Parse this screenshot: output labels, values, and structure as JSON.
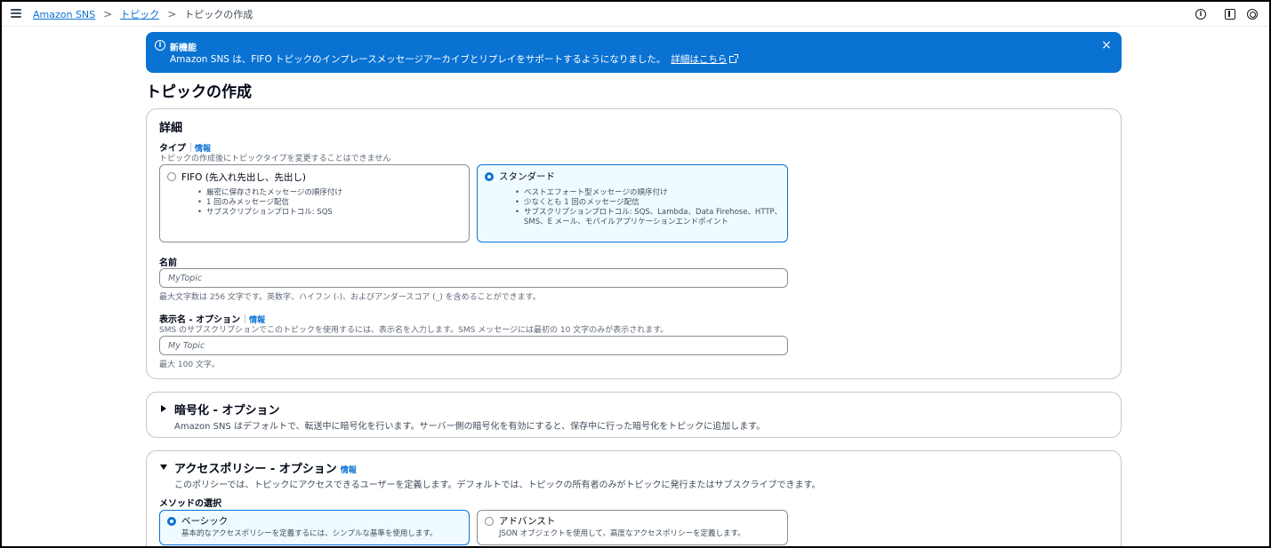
{
  "breadcrumb": {
    "items": [
      {
        "label": "Amazon SNS"
      },
      {
        "label": "トピック"
      }
    ],
    "current": "トピックの作成",
    "separator": ">"
  },
  "topbar": {
    "icons": [
      "info-icon",
      "panel-icon",
      "settings-icon"
    ]
  },
  "flash": {
    "title": "新機能",
    "message": "Amazon SNS は、FIFO トピックのインプレースメッセージアーカイブとリプレイをサポートするようになりました。",
    "link": "詳細はこちら",
    "close": "×",
    "color": "#0972d3"
  },
  "page_title": "トピックの作成",
  "details": {
    "heading": "詳細",
    "type_label": "タイプ",
    "info": "情報",
    "type_desc": "トピックの作成後にトピックタイプを変更することはできません",
    "fifo": {
      "title": "FIFO (先入れ先出し、先出し)",
      "bullets": [
        "厳密に保存されたメッセージの順序付け",
        "1 回のみメッセージ配信",
        "サブスクリプションプロトコル: SQS"
      ],
      "selected": false
    },
    "standard": {
      "title": "スタンダード",
      "bullets": [
        "ベストエフォート型メッセージの順序付け",
        "少なくとも 1 回のメッセージ配信",
        "サブスクリプションプロトコル: SQS、Lambda、Data Firehose、HTTP、"
      ],
      "bullet3_cont": "SMS、E メール、モバイルアプリケーションエンドポイント",
      "selected": true
    },
    "name_label": "名前",
    "name_placeholder": "MyTopic",
    "name_hint": "最大文字数は 256 文字です。英数字、ハイフン (-)、およびアンダースコア (_) を含めることができます。",
    "display_label": "表示名 - オプション",
    "display_desc": "SMS のサブスクリプションでこのトピックを使用するには、表示名を入力します。SMS メッセージには最初の 10 文字のみが表示されます。",
    "display_placeholder": "My Topic",
    "display_hint": "最大 100 文字。"
  },
  "encryption": {
    "heading": "暗号化 - オプション",
    "desc": "Amazon SNS はデフォルトで、転送中に暗号化を行います。サーバー側の暗号化を有効にすると、保存中に行った暗号化をトピックに追加します。",
    "expanded": false
  },
  "access_policy": {
    "heading": "アクセスポリシー - オプション",
    "info": "情報",
    "desc": "このポリシーでは、トピックにアクセスできるユーザーを定義します。デフォルトでは、トピックの所有者のみがトピックに発行またはサブスクライブできます。",
    "method_label": "メソッドの選択",
    "basic": {
      "title": "ベーシック",
      "desc": "基本的なアクセスポリシーを定義するには、シンプルな基準を使用します。",
      "selected": true
    },
    "advanced": {
      "title": "アドバンスト",
      "desc": "JSON オブジェクトを使用して、高度なアクセスポリシーを定義します。",
      "selected": false
    },
    "expanded": true
  }
}
